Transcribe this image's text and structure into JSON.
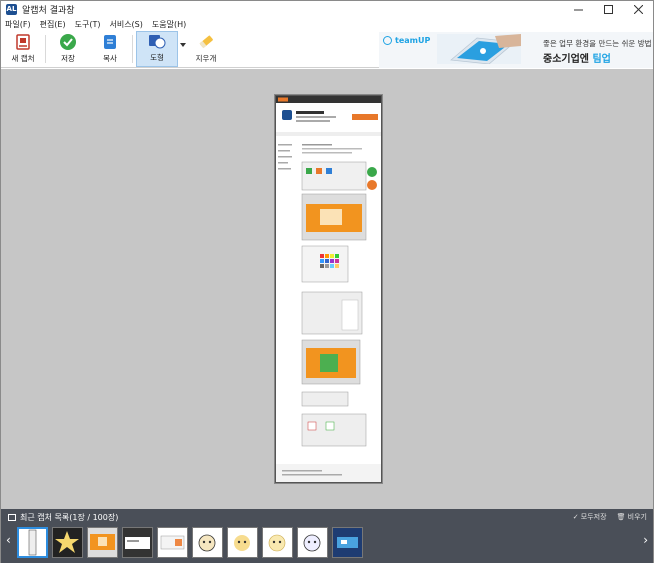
{
  "window": {
    "title": "알캡처 결과창",
    "app_icon_text": "AL"
  },
  "menu": [
    "파일(F)",
    "편집(E)",
    "도구(T)",
    "서비스(S)",
    "도움말(H)"
  ],
  "toolbar": {
    "new_capture": "새 캡처",
    "save": "저장",
    "copy": "복사",
    "shape": "도형",
    "eraser": "지우개"
  },
  "ad": {
    "brand": "teamUP",
    "line1": "좋은 업무 환경을 만드는 쉬운 방법",
    "line2_prefix": "중소기업엔 ",
    "line2_highlight": "팀업"
  },
  "bottom": {
    "title": "최근 캡처 목록(1장 / 100장)",
    "save_all": "✓ 모두저장",
    "clear": "🗑 비우기"
  },
  "colors": {
    "canvas_bg": "#c6c6c6",
    "panel_bg": "#4a4f58",
    "accent": "#2e8ee0",
    "save_green": "#3aa84a",
    "copy_blue": "#2f7fd6"
  }
}
